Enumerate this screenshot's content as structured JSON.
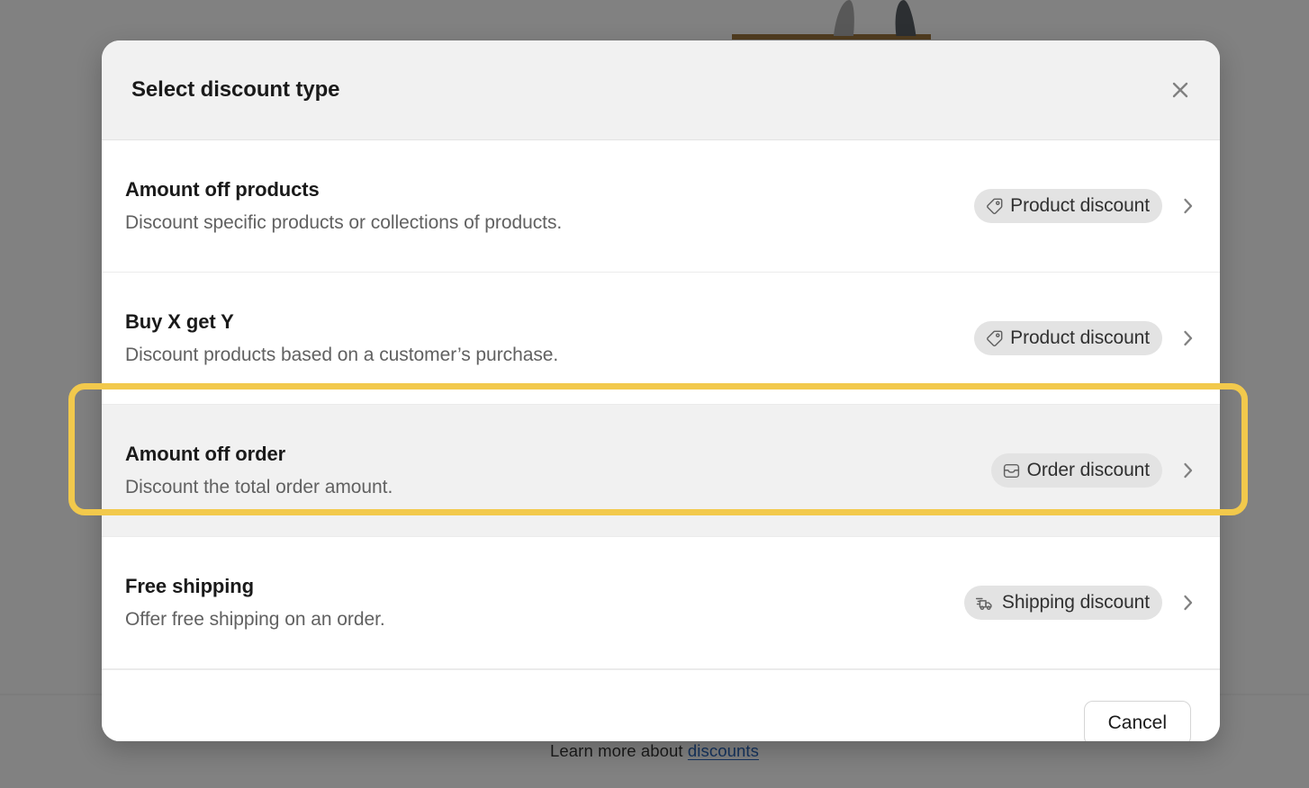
{
  "background": {
    "learn_more_prefix": "Learn more about ",
    "learn_more_link": "discounts"
  },
  "modal": {
    "title": "Select discount type",
    "close_icon": "close-icon",
    "options": [
      {
        "title": "Amount off products",
        "description": "Discount specific products or collections of products.",
        "badge_label": "Product discount",
        "badge_icon": "price-tag-icon",
        "chevron_icon": "chevron-right-icon",
        "selected": false
      },
      {
        "title": "Buy X get Y",
        "description": "Discount products based on a customer’s purchase.",
        "badge_label": "Product discount",
        "badge_icon": "price-tag-icon",
        "chevron_icon": "chevron-right-icon",
        "selected": false
      },
      {
        "title": "Amount off order",
        "description": "Discount the total order amount.",
        "badge_label": "Order discount",
        "badge_icon": "order-inbox-icon",
        "chevron_icon": "chevron-right-icon",
        "selected": true
      },
      {
        "title": "Free shipping",
        "description": "Offer free shipping on an order.",
        "badge_label": "Shipping discount",
        "badge_icon": "delivery-truck-icon",
        "chevron_icon": "chevron-right-icon",
        "selected": false
      }
    ],
    "footer": {
      "cancel_label": "Cancel"
    }
  },
  "colors": {
    "highlight_annotation": "#f2c94c",
    "badge_background": "#e3e3e3",
    "header_background": "#f1f1f1",
    "link": "#0f4fa8"
  }
}
